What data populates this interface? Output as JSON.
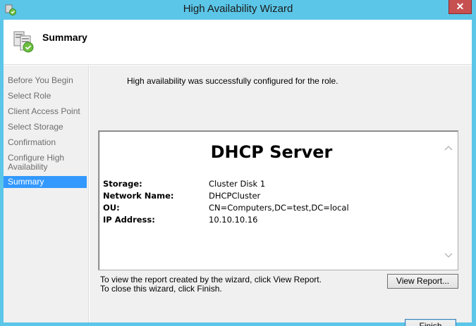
{
  "window": {
    "title": "High Availability Wizard",
    "close_label": "✕"
  },
  "header": {
    "title": "Summary"
  },
  "sidebar": {
    "items": [
      {
        "label": "Before You Begin"
      },
      {
        "label": "Select Role"
      },
      {
        "label": "Client Access Point"
      },
      {
        "label": "Select Storage"
      },
      {
        "label": "Confirmation"
      },
      {
        "label": "Configure High Availability"
      },
      {
        "label": "Summary"
      }
    ],
    "active_index": 6
  },
  "content": {
    "success_message": "High availability was successfully configured for the role.",
    "report": {
      "heading": "DHCP Server",
      "rows": [
        {
          "key": "Storage:",
          "value": "Cluster Disk 1"
        },
        {
          "key": "Network Name:",
          "value": "DHCPCluster"
        },
        {
          "key": "OU:",
          "value": "CN=Computers,DC=test,DC=local"
        },
        {
          "key": "IP Address:",
          "value": "10.10.10.16"
        }
      ]
    },
    "hint_line1": "To view the report created by the wizard, click View Report.",
    "hint_line2": "To close this wizard, click Finish.",
    "view_report_label": "View Report...",
    "finish_label": "Finish"
  },
  "colors": {
    "titlebar": "#5bc6e8",
    "selected": "#3399ff",
    "close": "#c75050"
  },
  "icons": {
    "app": "cluster-wizard-icon",
    "header": "server-cluster-icon",
    "scroll_up": "chevron-up-icon",
    "scroll_down": "chevron-down-icon"
  }
}
